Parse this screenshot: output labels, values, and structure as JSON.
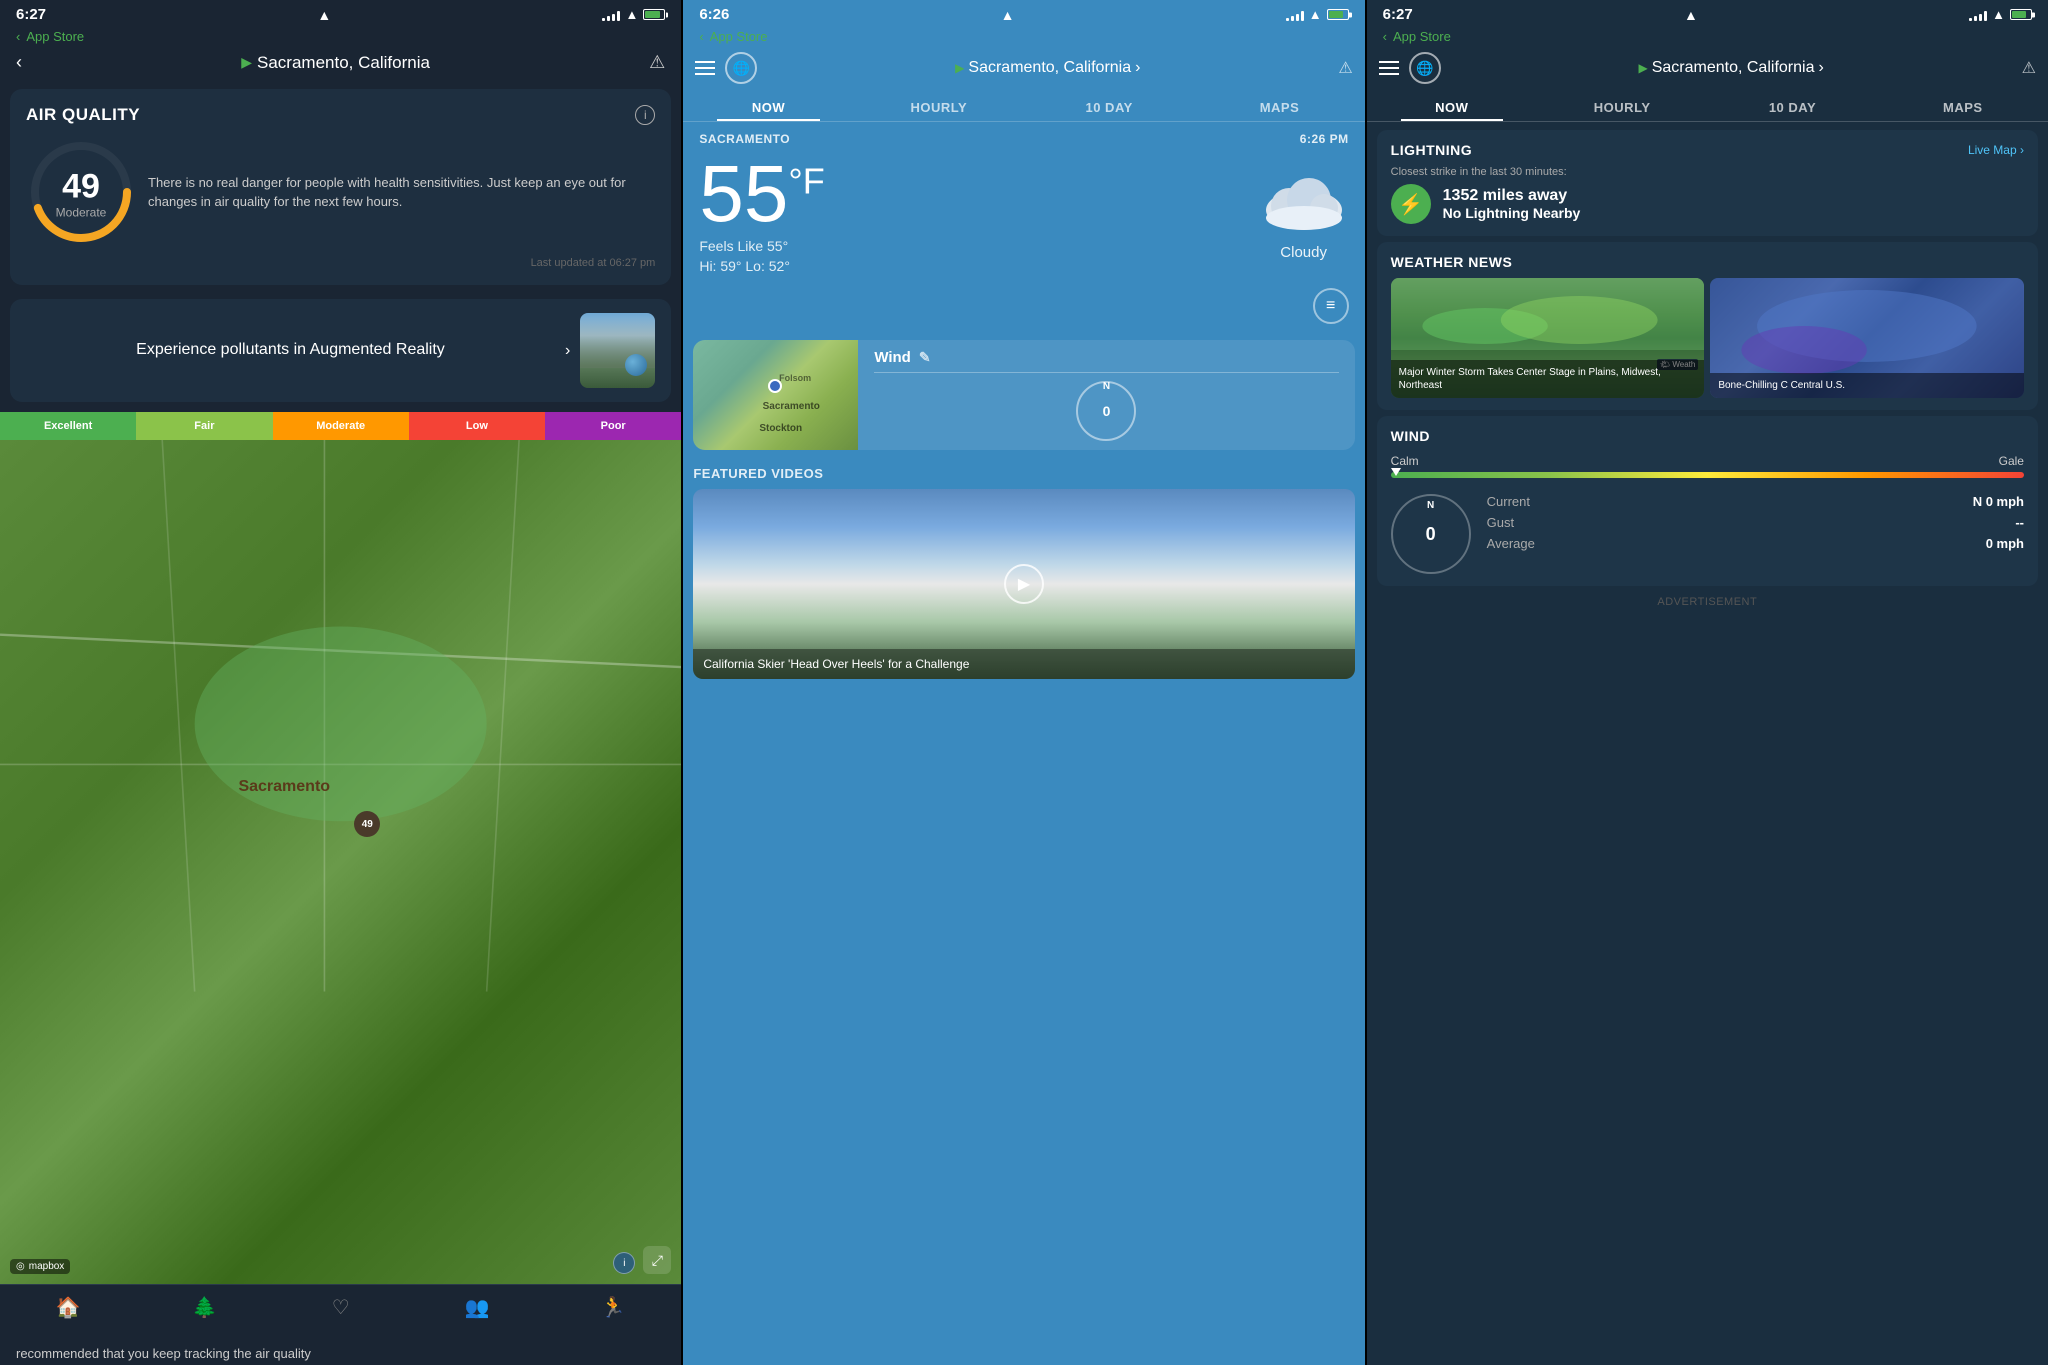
{
  "screen1": {
    "status": {
      "time": "6:27",
      "arrow": "▲"
    },
    "header": {
      "back": "‹",
      "location": "Sacramento, California",
      "alert": "⚠"
    },
    "airQuality": {
      "title": "AIR QUALITY",
      "number": "49",
      "label": "Moderate",
      "description": "There is no real danger for people with health sensitivities. Just keep an eye out for changes in air quality for the next few hours.",
      "updated": "Last updated at 06:27 pm"
    },
    "ar": {
      "text": "Experience pollutants in Augmented Reality",
      "chevron": "›"
    },
    "qualityBar": [
      {
        "label": "Excellent",
        "class": "seg-excellent"
      },
      {
        "label": "Fair",
        "class": "seg-fair"
      },
      {
        "label": "Moderate",
        "class": "seg-moderate"
      },
      {
        "label": "Low",
        "class": "seg-low"
      },
      {
        "label": "Poor",
        "class": "seg-poor"
      }
    ],
    "map": {
      "sacLabel": "Sacramento",
      "badge": "49",
      "mapboxLabel": "mapbox"
    },
    "nav": [
      {
        "icon": "🏠",
        "label": "home",
        "active": true
      },
      {
        "icon": "🌲",
        "label": "nature"
      },
      {
        "icon": "❤",
        "label": "health"
      },
      {
        "icon": "👥",
        "label": "social"
      },
      {
        "icon": "🏃",
        "label": "activity"
      }
    ],
    "bottomText": "recommended that you keep tracking the air quality"
  },
  "screen2": {
    "status": {
      "time": "6:26",
      "arrow": "▲"
    },
    "nav": {
      "location": "Sacramento, California",
      "arrow": "›",
      "alert": "⚠"
    },
    "tabs": [
      {
        "label": "NOW",
        "active": true
      },
      {
        "label": "HOURLY"
      },
      {
        "label": "10 DAY"
      },
      {
        "label": "MAPS"
      }
    ],
    "locationTime": {
      "place": "SACRAMENTO",
      "time": "6:26 PM"
    },
    "weather": {
      "temp": "55",
      "unit": "°F",
      "feelsLike": "Feels Like 55°",
      "hiLo": "Hi: 59°  Lo: 52°",
      "condition": "Cloudy"
    },
    "wind": {
      "title": "Wind",
      "compassVal": "0"
    },
    "videos": {
      "title": "FEATURED VIDEOS",
      "caption": "California Skier 'Head Over Heels' for a Challenge"
    }
  },
  "screen3": {
    "status": {
      "time": "6:27",
      "arrow": "▲"
    },
    "nav": {
      "location": "Sacramento, California",
      "arrow": "›",
      "alert": "⚠"
    },
    "tabs": [
      {
        "label": "NOW",
        "active": true
      },
      {
        "label": "HOURLY"
      },
      {
        "label": "10 DAY"
      },
      {
        "label": "MAPS"
      }
    ],
    "lightning": {
      "title": "LIGHTNING",
      "liveMap": "Live Map ›",
      "closest": "Closest strike in the last 30 minutes:",
      "distance": "1352 miles away",
      "nearby": "No Lightning Nearby"
    },
    "weatherNews": {
      "title": "WEATHER NEWS",
      "img1Caption": "Major Winter Storm Takes Center Stage in Plains, Midwest, Northeast",
      "img2Caption": "Bone-Chilling C Central U.S."
    },
    "wind": {
      "title": "WIND",
      "calm": "Calm",
      "gale": "Gale",
      "current": "N 0 mph",
      "gust": "--",
      "average": "0 mph",
      "compassVal": "0"
    },
    "ad": "ADVERTISEMENT"
  }
}
